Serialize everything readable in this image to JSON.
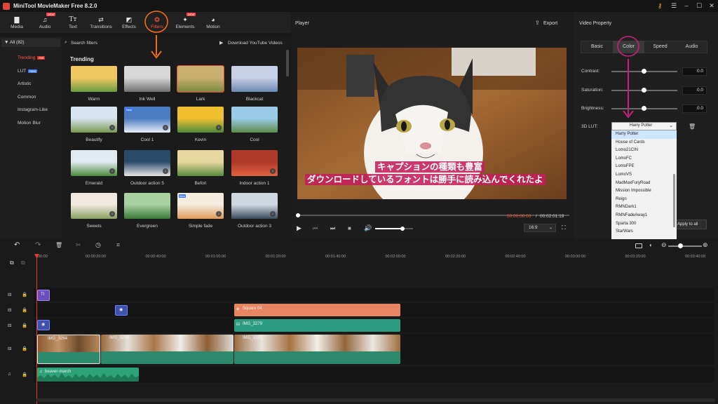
{
  "window": {
    "title": "MiniTool MovieMaker Free 8.2.0"
  },
  "toolbar": [
    {
      "label": "Media",
      "icon": "folder-icon"
    },
    {
      "label": "Audio",
      "icon": "music-note-icon",
      "badge": "NEW"
    },
    {
      "label": "Text",
      "icon": "text-icon"
    },
    {
      "label": "Transitions",
      "icon": "transitions-icon"
    },
    {
      "label": "Effects",
      "icon": "effects-icon"
    },
    {
      "label": "Filters",
      "icon": "filters-icon",
      "active": true
    },
    {
      "label": "Elements",
      "icon": "elements-icon",
      "badge": "NEW"
    },
    {
      "label": "Motion",
      "icon": "motion-icon"
    }
  ],
  "categories": {
    "all": "All (82)",
    "items": [
      {
        "label": "Trending",
        "badge": "Hot",
        "active": true
      },
      {
        "label": "LUT",
        "badge": "New"
      },
      {
        "label": "Artistic"
      },
      {
        "label": "Common"
      },
      {
        "label": "Instagram-Like"
      },
      {
        "label": "Motion Blur"
      }
    ]
  },
  "filters": {
    "search_placeholder": "Search filters",
    "download_label": "Download YouTube Videos",
    "section": "Trending",
    "items": [
      {
        "label": "Warm"
      },
      {
        "label": "Ink Well"
      },
      {
        "label": "Lark",
        "selected": true
      },
      {
        "label": "Blackcat"
      },
      {
        "label": "Beautify"
      },
      {
        "label": "Cool 1"
      },
      {
        "label": "Kevin"
      },
      {
        "label": "Cool"
      },
      {
        "label": "Emerald"
      },
      {
        "label": "Outdoor action 5"
      },
      {
        "label": "Befori"
      },
      {
        "label": "Indoor action 1"
      },
      {
        "label": "Sweets"
      },
      {
        "label": "Evergreen"
      },
      {
        "label": "Simple fade"
      },
      {
        "label": "Outdoor action 3"
      }
    ]
  },
  "player": {
    "title": "Player",
    "export_label": "Export",
    "caption_line1": "キャプションの種類も豊富",
    "caption_line2": "ダウンロードしているフォントは勝手に読み込んでくれたよ",
    "current_time": "00:00:00:00",
    "separator": "/",
    "total_time": "00:02:01:19",
    "aspect_ratio": "16:9",
    "volume_level": 0.72
  },
  "properties": {
    "title": "Video Property",
    "tabs": [
      "Basic",
      "Color",
      "Speed",
      "Audio"
    ],
    "active_tab": "Color",
    "contrast": {
      "label": "Contrast:",
      "value": "0.0"
    },
    "saturation": {
      "label": "Saturation:",
      "value": "0.0"
    },
    "brightness": {
      "label": "Brightness:",
      "value": "0.0"
    },
    "lut": {
      "label": "3D LUT:",
      "selected": "Harry Potter",
      "options": [
        "Harry Potter",
        "House of Cards",
        "Lomo21CIN",
        "LomoFC",
        "LomoFPE",
        "LomoVS",
        "MadMaxFuryRoad",
        "Mission Impossible",
        "Reign",
        "RMNDark1",
        "RMNFadeAway1",
        "Sparta 300",
        "StarWars"
      ]
    },
    "apply_all_label": "Apply to all"
  },
  "timeline": {
    "ruler": [
      "00:00",
      "00:00:20:00",
      "00:00:40:00",
      "00:01:00:00",
      "00:01:20:00",
      "00:01:40:00",
      "00:02:00:00",
      "00:02:20:00",
      "00:02:40:00",
      "00:03:00:00",
      "00:03:20:00",
      "00:03:40:00"
    ],
    "text_clip": "Tt",
    "element_clip": "Square 04",
    "overlay_clip": "IMG_3279",
    "video_clips": [
      "IMG_3264",
      "IMG_3268",
      "IMG_3281"
    ],
    "audio_clip": "beaver-march"
  },
  "colors": {
    "accent": "#ff5a3c",
    "annotation": "#f26a1b",
    "annotation_pink": "#c8217a",
    "audio_clip": "#2ea37a",
    "element_clip": "#e88562",
    "overlay_clip": "#2d9d81",
    "caption_bg": "#c41e5a"
  }
}
